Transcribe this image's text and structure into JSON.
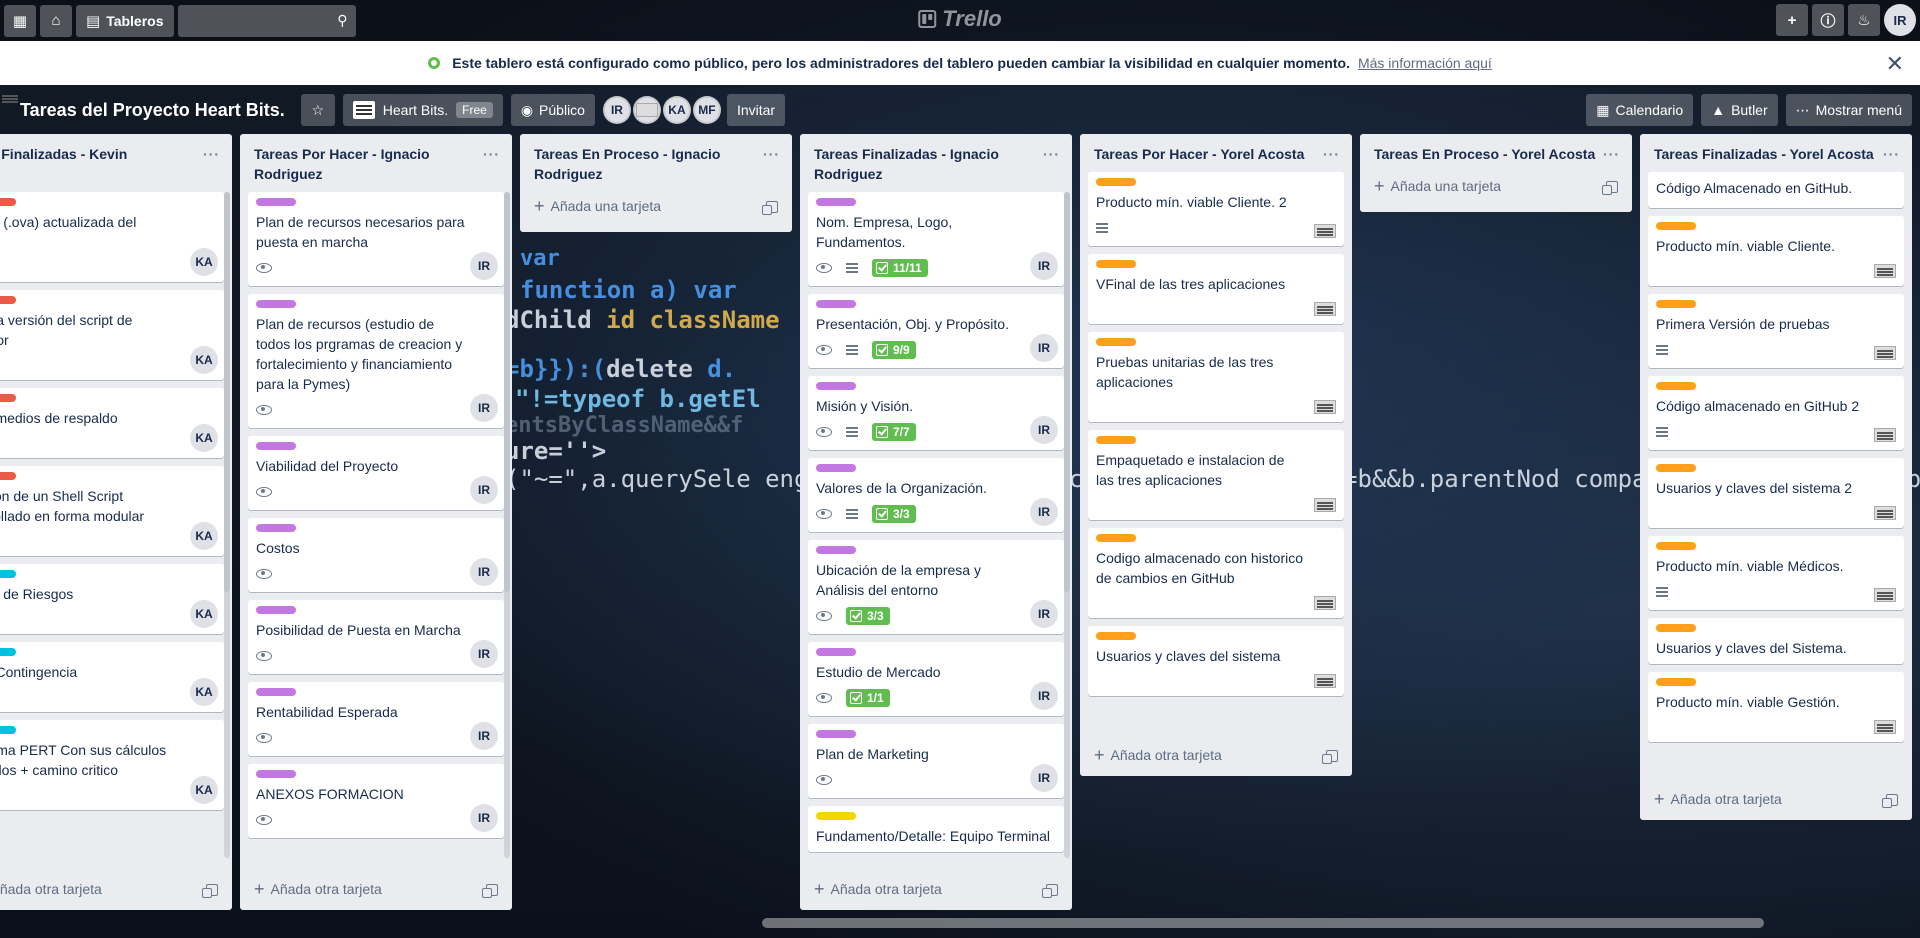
{
  "app": {
    "title": "Trello"
  },
  "topbar": {
    "boards_label": "Tableros",
    "avatar": "IR"
  },
  "banner": {
    "message": "Este tablero está configurado como público, pero los administradores del tablero pueden cambiar la visibilidad en cualquier momento.",
    "link": "Más información aquí"
  },
  "board": {
    "title": "Tareas del Proyecto Heart Bits.",
    "workspace": "Heart Bits.",
    "workspace_badge": "Free",
    "visibility": "Público",
    "members": [
      "IR",
      "",
      "KA",
      "MF"
    ],
    "invite": "Invitar",
    "calendar": "Calendario",
    "butler": "Butler",
    "menu": "Mostrar menú"
  },
  "colors": {
    "red": "#eb5a46",
    "cyan": "#00c2e0",
    "purple": "#c377e0",
    "orange": "#ff9f1a",
    "yellow": "#f2d600",
    "green": "#61bd4f"
  },
  "add_card_label": "Añada otra tarjeta",
  "add_first_label": "Añada una tarjeta",
  "lists": [
    {
      "title": "Tareas Finalizadas - Kevin Rendón",
      "title_display": "eas Finalizadas - Kevin\ndón",
      "cards": [
        {
          "label": "red",
          "title": "gen (.ova) actualizada del\nidor",
          "member": "KA"
        },
        {
          "label": "red",
          "title": "nera versión del script de\nrador",
          "member": "KA"
        },
        {
          "label": "red",
          "title": "nir medios de respaldo",
          "member": "KA"
        },
        {
          "label": "red",
          "title": "ación de un Shell Script\narrollado en forma modular",
          "member": "KA"
        },
        {
          "label": "cyan",
          "title": "lisis de Riesgos",
          "member": "KA"
        },
        {
          "label": "cyan",
          "title": "de Contingencia",
          "member": "KA"
        },
        {
          "label": "cyan",
          "title": "grama PERT Con sus cálculos\nciados + camino critico",
          "member": "KA"
        }
      ]
    },
    {
      "title": "Tareas Por Hacer - Ignacio Rodriguez",
      "cards": [
        {
          "label": "purple",
          "title": "Plan de recursos necesarios para puesta en marcha",
          "eye": true,
          "member": "IR"
        },
        {
          "label": "purple",
          "title": "Plan de recursos (estudio de todos los prgramas de creacion y fortalecimiento y financiamiento para la Pymes)",
          "eye": true,
          "member": "IR"
        },
        {
          "label": "purple",
          "title": "Viabilidad del Proyecto",
          "eye": true,
          "member": "IR"
        },
        {
          "label": "purple",
          "title": "Costos",
          "eye": true,
          "member": "IR"
        },
        {
          "label": "purple",
          "title": "Posibilidad de Puesta en Marcha",
          "eye": true,
          "member": "IR"
        },
        {
          "label": "purple",
          "title": "Rentabilidad Esperada",
          "eye": true,
          "member": "IR"
        },
        {
          "label": "purple",
          "title": "ANEXOS FORMACION",
          "eye": true,
          "member": "IR"
        }
      ]
    },
    {
      "title": "Tareas En Proceso - Ignacio Rodriguez",
      "cards": []
    },
    {
      "title": "Tareas Finalizadas - Ignacio Rodriguez",
      "cards": [
        {
          "label": "purple",
          "title": "Nom. Empresa, Logo, Fundamentos.",
          "eye": true,
          "desc": true,
          "check": "11/11",
          "member": "IR"
        },
        {
          "label": "purple",
          "title": "Presentación, Obj. y Propósito.",
          "eye": true,
          "desc": true,
          "check": "9/9",
          "member": "IR"
        },
        {
          "label": "purple",
          "title": "Misión y Visión.",
          "eye": true,
          "desc": true,
          "check": "7/7",
          "member": "IR"
        },
        {
          "label": "purple",
          "title": "Valores de la Organización.",
          "eye": true,
          "desc": true,
          "check": "3/3",
          "member": "IR"
        },
        {
          "label": "purple",
          "title": "Ubicación de la empresa y Análisis del entorno",
          "eye": true,
          "check": "3/3",
          "member": "IR"
        },
        {
          "label": "purple",
          "title": "Estudio de Mercado",
          "eye": true,
          "check": "1/1",
          "member": "IR"
        },
        {
          "label": "purple",
          "title": "Plan de Marketing",
          "eye": true,
          "member": "IR"
        },
        {
          "label": "yellow",
          "title": "Fundamento/Detalle: Equipo Terminal",
          "member": ""
        }
      ]
    },
    {
      "title": "Tareas Por Hacer - Yorel Acosta",
      "cards": [
        {
          "label": "orange",
          "title": "Producto mín. viable Cliente. 2",
          "desc": true,
          "img": true
        },
        {
          "label": "orange",
          "title": "VFinal de las tres aplicaciones",
          "img": true
        },
        {
          "label": "orange",
          "title": "Pruebas unitarias de las tres aplicaciones",
          "img": true
        },
        {
          "label": "orange",
          "title": "Empaquetado e instalacion de las tres aplicaciones",
          "img": true
        },
        {
          "label": "orange",
          "title": "Codigo almacenado con historico de cambios en GitHub",
          "img": true
        },
        {
          "label": "orange",
          "title": "Usuarios y claves del sistema",
          "img": true
        }
      ]
    },
    {
      "title": "Tareas En Proceso - Yorel Acosta",
      "cards": []
    },
    {
      "title": "Tareas Finalizadas - Yorel Acosta",
      "cards": [
        {
          "label": "",
          "title": "Código Almacenado en GitHub."
        },
        {
          "label": "orange",
          "title": "Producto mín. viable Cliente.",
          "img": true
        },
        {
          "label": "orange",
          "title": "Primera Versión de pruebas",
          "desc": true,
          "img": true
        },
        {
          "label": "orange",
          "title": "Código almacenado en GitHub 2",
          "desc": true,
          "img": true
        },
        {
          "label": "orange",
          "title": "Usuarios y claves del sistema 2",
          "img": true
        },
        {
          "label": "orange",
          "title": "Producto mín. viable Médicos.",
          "desc": true,
          "img": true
        },
        {
          "label": "orange",
          "title": "Usuarios y claves del Sistema."
        },
        {
          "label": "orange",
          "title": "Producto mín. viable Gestión.",
          "img": true
        }
      ]
    }
  ]
}
